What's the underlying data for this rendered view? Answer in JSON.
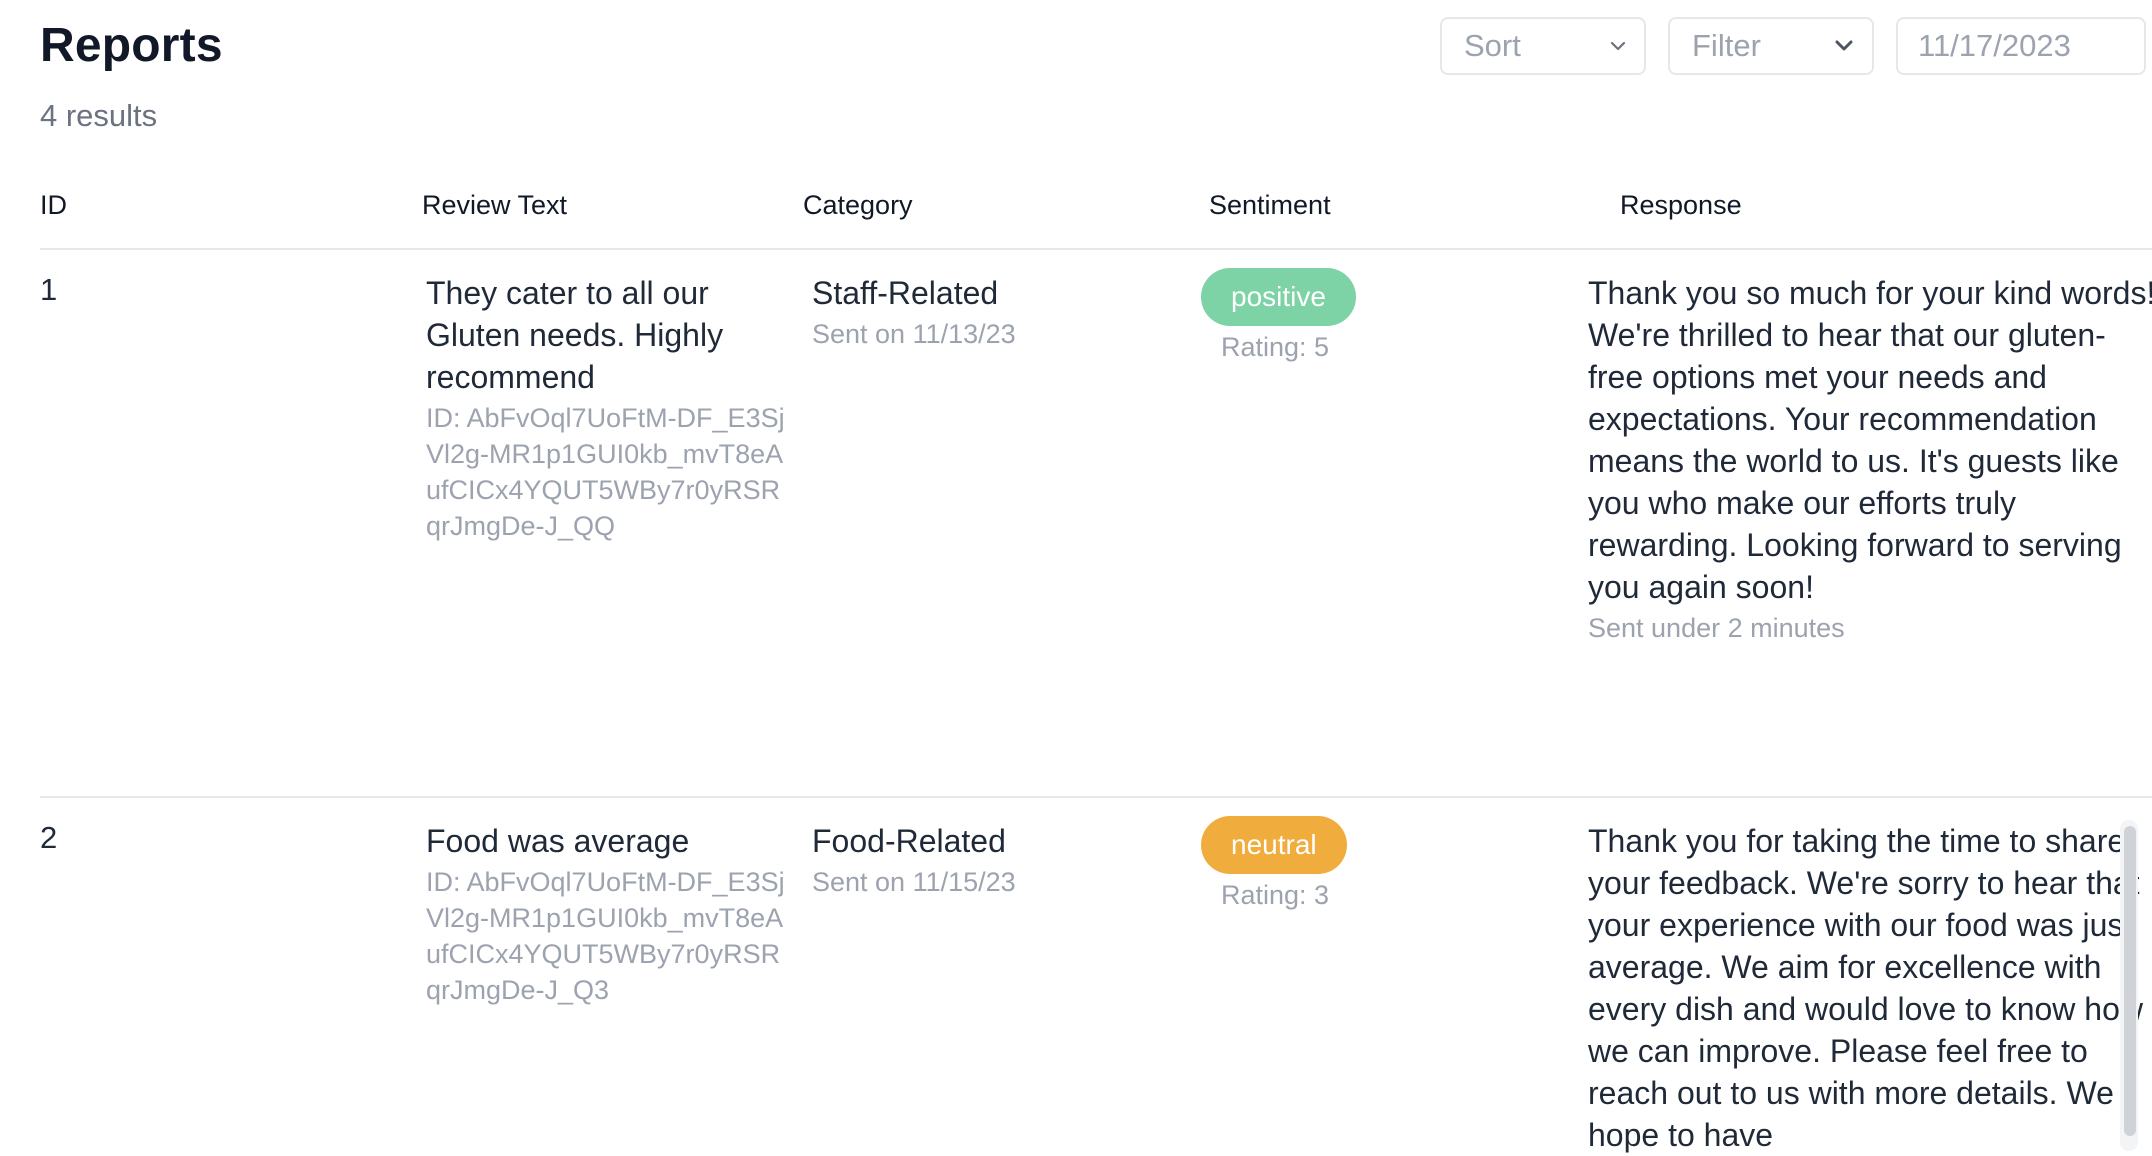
{
  "page": {
    "title": "Reports",
    "result_count": "4 results"
  },
  "controls": {
    "sort_label": "Sort",
    "sort_icon": "chevron-down-icon",
    "filter_label": "Filter",
    "filter_icon": "chevron-down-icon",
    "date_value": "11/17/2023"
  },
  "table": {
    "headers": {
      "id": "ID",
      "review": "Review Text",
      "category": "Category",
      "sentiment": "Sentiment",
      "response": "Response"
    },
    "rows": [
      {
        "id": "1",
        "review_text": "They cater to all our Gluten needs. Highly recommend",
        "review_id": "ID: AbFvOql7UoFtM-DF_E3SjVl2g-MR1p1GUI0kb_mvT8eAufCICx4YQUT5WBy7r0yRSRqrJmgDe-J_QQ",
        "category": "Staff-Related",
        "sent_on": "Sent on 11/13/23",
        "sentiment": "positive",
        "sentiment_color": "#7dd3a5",
        "rating": "Rating: 5",
        "response": "Thank you so much for your kind words! We're thrilled to hear that our gluten-free options met your needs and expectations. Your recommendation means the world to us. It's guests like you who make our efforts truly rewarding. Looking forward to serving you again soon!",
        "response_sent": "Sent under 2 minutes"
      },
      {
        "id": "2",
        "review_text": "Food was average",
        "review_id": "ID: AbFvOql7UoFtM-DF_E3SjVl2g-MR1p1GUI0kb_mvT8eAufCICx4YQUT5WBy7r0yRSRqrJmgDe-J_Q3",
        "category": "Food-Related",
        "sent_on": "Sent on 11/15/23",
        "sentiment": "neutral",
        "sentiment_color": "#f0ad3e",
        "rating": "Rating: 3",
        "response": "Thank you for taking the time to share your feedback. We're sorry to hear that your experience with our food was just average. We aim for excellence with every dish and would love to know how we can improve. Please feel free to reach out to us with more details. We hope to have"
      }
    ]
  }
}
